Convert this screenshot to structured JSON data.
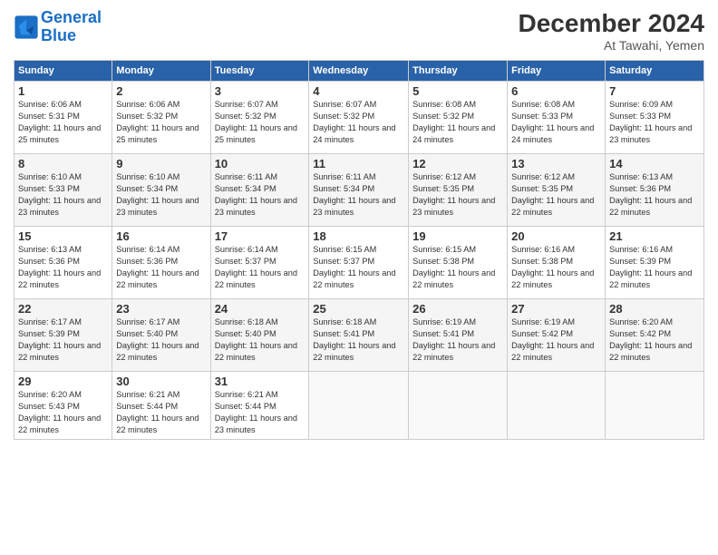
{
  "header": {
    "logo_text_general": "General",
    "logo_text_blue": "Blue",
    "title": "December 2024",
    "subtitle": "At Tawahi, Yemen"
  },
  "calendar": {
    "days_of_week": [
      "Sunday",
      "Monday",
      "Tuesday",
      "Wednesday",
      "Thursday",
      "Friday",
      "Saturday"
    ],
    "weeks": [
      [
        {
          "day": "1",
          "sunrise": "6:06 AM",
          "sunset": "5:31 PM",
          "daylight": "11 hours and 25 minutes."
        },
        {
          "day": "2",
          "sunrise": "6:06 AM",
          "sunset": "5:32 PM",
          "daylight": "11 hours and 25 minutes."
        },
        {
          "day": "3",
          "sunrise": "6:07 AM",
          "sunset": "5:32 PM",
          "daylight": "11 hours and 25 minutes."
        },
        {
          "day": "4",
          "sunrise": "6:07 AM",
          "sunset": "5:32 PM",
          "daylight": "11 hours and 24 minutes."
        },
        {
          "day": "5",
          "sunrise": "6:08 AM",
          "sunset": "5:32 PM",
          "daylight": "11 hours and 24 minutes."
        },
        {
          "day": "6",
          "sunrise": "6:08 AM",
          "sunset": "5:33 PM",
          "daylight": "11 hours and 24 minutes."
        },
        {
          "day": "7",
          "sunrise": "6:09 AM",
          "sunset": "5:33 PM",
          "daylight": "11 hours and 23 minutes."
        }
      ],
      [
        {
          "day": "8",
          "sunrise": "6:10 AM",
          "sunset": "5:33 PM",
          "daylight": "11 hours and 23 minutes."
        },
        {
          "day": "9",
          "sunrise": "6:10 AM",
          "sunset": "5:34 PM",
          "daylight": "11 hours and 23 minutes."
        },
        {
          "day": "10",
          "sunrise": "6:11 AM",
          "sunset": "5:34 PM",
          "daylight": "11 hours and 23 minutes."
        },
        {
          "day": "11",
          "sunrise": "6:11 AM",
          "sunset": "5:34 PM",
          "daylight": "11 hours and 23 minutes."
        },
        {
          "day": "12",
          "sunrise": "6:12 AM",
          "sunset": "5:35 PM",
          "daylight": "11 hours and 23 minutes."
        },
        {
          "day": "13",
          "sunrise": "6:12 AM",
          "sunset": "5:35 PM",
          "daylight": "11 hours and 22 minutes."
        },
        {
          "day": "14",
          "sunrise": "6:13 AM",
          "sunset": "5:36 PM",
          "daylight": "11 hours and 22 minutes."
        }
      ],
      [
        {
          "day": "15",
          "sunrise": "6:13 AM",
          "sunset": "5:36 PM",
          "daylight": "11 hours and 22 minutes."
        },
        {
          "day": "16",
          "sunrise": "6:14 AM",
          "sunset": "5:36 PM",
          "daylight": "11 hours and 22 minutes."
        },
        {
          "day": "17",
          "sunrise": "6:14 AM",
          "sunset": "5:37 PM",
          "daylight": "11 hours and 22 minutes."
        },
        {
          "day": "18",
          "sunrise": "6:15 AM",
          "sunset": "5:37 PM",
          "daylight": "11 hours and 22 minutes."
        },
        {
          "day": "19",
          "sunrise": "6:15 AM",
          "sunset": "5:38 PM",
          "daylight": "11 hours and 22 minutes."
        },
        {
          "day": "20",
          "sunrise": "6:16 AM",
          "sunset": "5:38 PM",
          "daylight": "11 hours and 22 minutes."
        },
        {
          "day": "21",
          "sunrise": "6:16 AM",
          "sunset": "5:39 PM",
          "daylight": "11 hours and 22 minutes."
        }
      ],
      [
        {
          "day": "22",
          "sunrise": "6:17 AM",
          "sunset": "5:39 PM",
          "daylight": "11 hours and 22 minutes."
        },
        {
          "day": "23",
          "sunrise": "6:17 AM",
          "sunset": "5:40 PM",
          "daylight": "11 hours and 22 minutes."
        },
        {
          "day": "24",
          "sunrise": "6:18 AM",
          "sunset": "5:40 PM",
          "daylight": "11 hours and 22 minutes."
        },
        {
          "day": "25",
          "sunrise": "6:18 AM",
          "sunset": "5:41 PM",
          "daylight": "11 hours and 22 minutes."
        },
        {
          "day": "26",
          "sunrise": "6:19 AM",
          "sunset": "5:41 PM",
          "daylight": "11 hours and 22 minutes."
        },
        {
          "day": "27",
          "sunrise": "6:19 AM",
          "sunset": "5:42 PM",
          "daylight": "11 hours and 22 minutes."
        },
        {
          "day": "28",
          "sunrise": "6:20 AM",
          "sunset": "5:42 PM",
          "daylight": "11 hours and 22 minutes."
        }
      ],
      [
        {
          "day": "29",
          "sunrise": "6:20 AM",
          "sunset": "5:43 PM",
          "daylight": "11 hours and 22 minutes."
        },
        {
          "day": "30",
          "sunrise": "6:21 AM",
          "sunset": "5:44 PM",
          "daylight": "11 hours and 22 minutes."
        },
        {
          "day": "31",
          "sunrise": "6:21 AM",
          "sunset": "5:44 PM",
          "daylight": "11 hours and 23 minutes."
        },
        null,
        null,
        null,
        null
      ]
    ]
  }
}
